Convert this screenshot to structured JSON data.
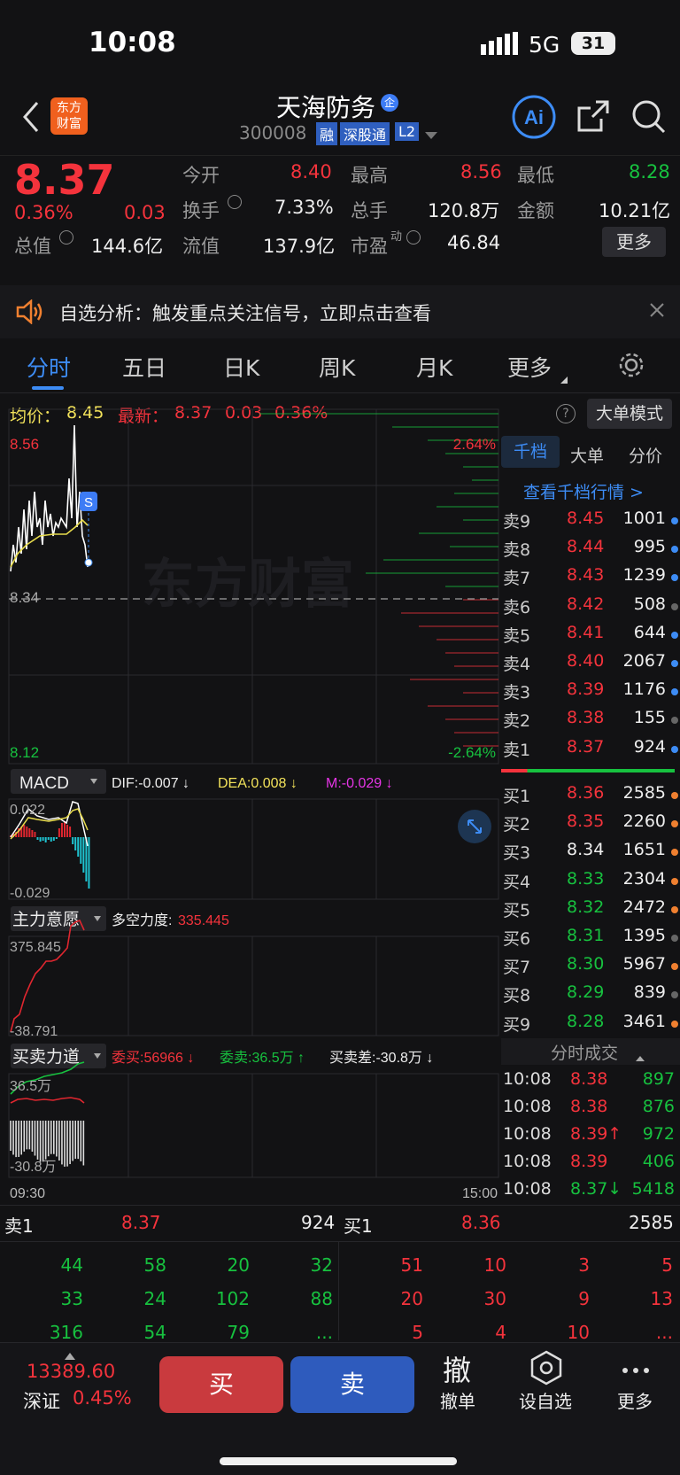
{
  "status": {
    "time": "10:08",
    "network": "5G",
    "battery": "31"
  },
  "header": {
    "name": "天海防务",
    "badge": "企",
    "code": "300008",
    "tags": [
      "融",
      "深股通",
      "L2"
    ],
    "logo": "东方财富"
  },
  "quote": {
    "price": "8.37",
    "pct": "0.36%",
    "change": "0.03",
    "open_label": "今开",
    "open": "8.40",
    "high_label": "最高",
    "high": "8.56",
    "low_label": "最低",
    "low": "8.28",
    "turnover_label": "换手",
    "turnover": "7.33%",
    "vol_label": "总手",
    "vol": "120.8万",
    "amt_label": "金额",
    "amt": "10.21亿",
    "mcap_label": "总值",
    "mcap": "144.6亿",
    "float_label": "流值",
    "float": "137.9亿",
    "pe_label": "市盈",
    "pe_sup": "动",
    "pe": "46.84",
    "more": "更多"
  },
  "notice": {
    "text": "自选分析：触发重点关注信号，立即点击查看"
  },
  "tabs": [
    "分时",
    "五日",
    "日K",
    "周K",
    "月K",
    "更多"
  ],
  "intraday": {
    "avg_label": "均价：",
    "avg": "8.45",
    "last_label": "最新：",
    "last": "8.37",
    "chg": "0.03",
    "pct": "0.36%",
    "mode": "大单模式",
    "high": "8.56",
    "mid": "8.34",
    "low": "8.12",
    "pct_up": "2.64%",
    "pct_dn": "-2.64%",
    "watermark": "东方财富",
    "s_marker": "S",
    "time_start": "09:30",
    "time_end": "15:00"
  },
  "macd": {
    "name": "MACD",
    "dif": "DIF:-0.007 ↓",
    "dea": "DEA:0.008 ↓",
    "m": "M:-0.029 ↓",
    "top": "0.022",
    "bot": "-0.029"
  },
  "zlyy": {
    "name": "主力意愿",
    "label": "多空力度:",
    "value": "335.445",
    "top": "375.845",
    "bot": "-38.791"
  },
  "mmld": {
    "name": "买卖力道",
    "buy": "委买:56966 ↓",
    "sell": "委卖:36.5万 ↑",
    "diff": "买卖差:-30.8万 ↓",
    "top": "36.5万",
    "bot": "-30.8万"
  },
  "orderbook": {
    "tabs": [
      "千档",
      "大单",
      "分价"
    ],
    "link": "查看千档行情 >",
    "asks": [
      [
        "卖9",
        "8.45",
        "1001"
      ],
      [
        "卖8",
        "8.44",
        "995"
      ],
      [
        "卖7",
        "8.43",
        "1239"
      ],
      [
        "卖6",
        "8.42",
        "508"
      ],
      [
        "卖5",
        "8.41",
        "644"
      ],
      [
        "卖4",
        "8.40",
        "2067"
      ],
      [
        "卖3",
        "8.39",
        "1176"
      ],
      [
        "卖2",
        "8.38",
        "155"
      ],
      [
        "卖1",
        "8.37",
        "924"
      ]
    ],
    "bids": [
      [
        "买1",
        "8.36",
        "2585"
      ],
      [
        "买2",
        "8.35",
        "2260"
      ],
      [
        "买3",
        "8.34",
        "1651"
      ],
      [
        "买4",
        "8.33",
        "2304"
      ],
      [
        "买5",
        "8.32",
        "2472"
      ],
      [
        "买6",
        "8.31",
        "1395"
      ],
      [
        "买7",
        "8.30",
        "5967"
      ],
      [
        "买8",
        "8.29",
        "839"
      ],
      [
        "买9",
        "8.28",
        "3461"
      ]
    ],
    "ticks_title": "分时成交",
    "ticks": [
      [
        "10:08",
        "8.38",
        "897"
      ],
      [
        "10:08",
        "8.38",
        "876"
      ],
      [
        "10:08",
        "8.39↑",
        "972"
      ],
      [
        "10:08",
        "8.39",
        "406"
      ],
      [
        "10:08",
        "8.37↓",
        "5418"
      ]
    ]
  },
  "queue": {
    "ask_label": "卖1",
    "ask_price": "8.37",
    "ask_vol": "924",
    "bid_label": "买1",
    "bid_price": "8.36",
    "bid_vol": "2585",
    "ask_cells": [
      "44",
      "58",
      "20",
      "32",
      "33",
      "24",
      "102",
      "88",
      "316",
      "54",
      "79",
      "..."
    ],
    "bid_cells": [
      "51",
      "10",
      "3",
      "5",
      "20",
      "30",
      "9",
      "13",
      "5",
      "4",
      "10",
      "..."
    ]
  },
  "footer": {
    "index_value": "13389.60",
    "index_name": "深证",
    "index_pct": "0.45%",
    "buy": "买",
    "sell": "卖",
    "cancel_icon": "撤",
    "cancel": "撤单",
    "watch": "设自选",
    "more": "更多"
  },
  "colors": {
    "up": "#f4333c",
    "down": "#17c13f",
    "accent": "#3d8cf5"
  }
}
